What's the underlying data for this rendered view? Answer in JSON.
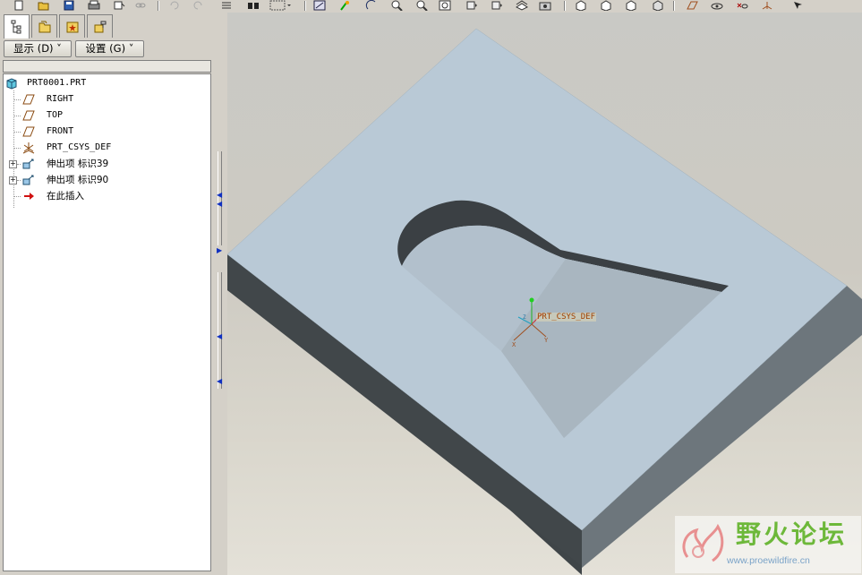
{
  "toolbar": {
    "icons": [
      "new-icon",
      "open-icon",
      "save-icon",
      "print-icon",
      "email-icon",
      "link-icon",
      "undo-icon",
      "redo-icon",
      "list-icon",
      "binoculars-icon",
      "select-box-icon",
      "repaint-icon",
      "spin-center-icon",
      "orient-icon",
      "zoom-in-icon",
      "zoom-out-icon",
      "refit-icon",
      "reorient-icon",
      "saved-views-icon",
      "layers-icon",
      "view-manager-icon",
      "shading-icon",
      "hidden-line-icon",
      "no-hidden-icon",
      "wireframe-icon",
      "datum-planes-icon",
      "datum-axes-icon",
      "datum-points-icon",
      "csys-icon",
      "annotation-icon"
    ]
  },
  "left_panel": {
    "tabs": [
      {
        "name": "model-tree-tab-icon",
        "active": true
      },
      {
        "name": "folder-browser-tab-icon",
        "active": false
      },
      {
        "name": "favorites-tab-icon",
        "active": false
      },
      {
        "name": "connections-tab-icon",
        "active": false
      }
    ],
    "menus": {
      "show_label": "显示 (D) ˅",
      "settings_label": "设置 (G) ˅"
    },
    "tree": {
      "root": "PRT0001.PRT",
      "items": [
        {
          "label": "RIGHT",
          "icon": "datum-plane-icon",
          "expandable": false
        },
        {
          "label": "TOP",
          "icon": "datum-plane-icon",
          "expandable": false
        },
        {
          "label": "FRONT",
          "icon": "datum-plane-icon",
          "expandable": false
        },
        {
          "label": "PRT_CSYS_DEF",
          "icon": "coordinate-system-icon",
          "expandable": false
        },
        {
          "label": "伸出项 标识39",
          "icon": "extrude-feature-icon",
          "expandable": true
        },
        {
          "label": "伸出项 标识90",
          "icon": "extrude-feature-icon",
          "expandable": true
        },
        {
          "label": "在此插入",
          "icon": "insert-here-arrow-icon",
          "expandable": false
        }
      ]
    }
  },
  "viewport": {
    "csys_label": "PRT_CSYS_DEF",
    "axis_x": "X",
    "axis_y": "Y",
    "axis_z": "Z",
    "colors": {
      "top_face": "#b9c9d6",
      "side_dark": "#3f4548",
      "side_mid": "#6d767c",
      "cut_floor": "#a9b6c0"
    }
  },
  "watermark": {
    "title": "野火论坛",
    "url": "www.proewildfire.cn"
  }
}
